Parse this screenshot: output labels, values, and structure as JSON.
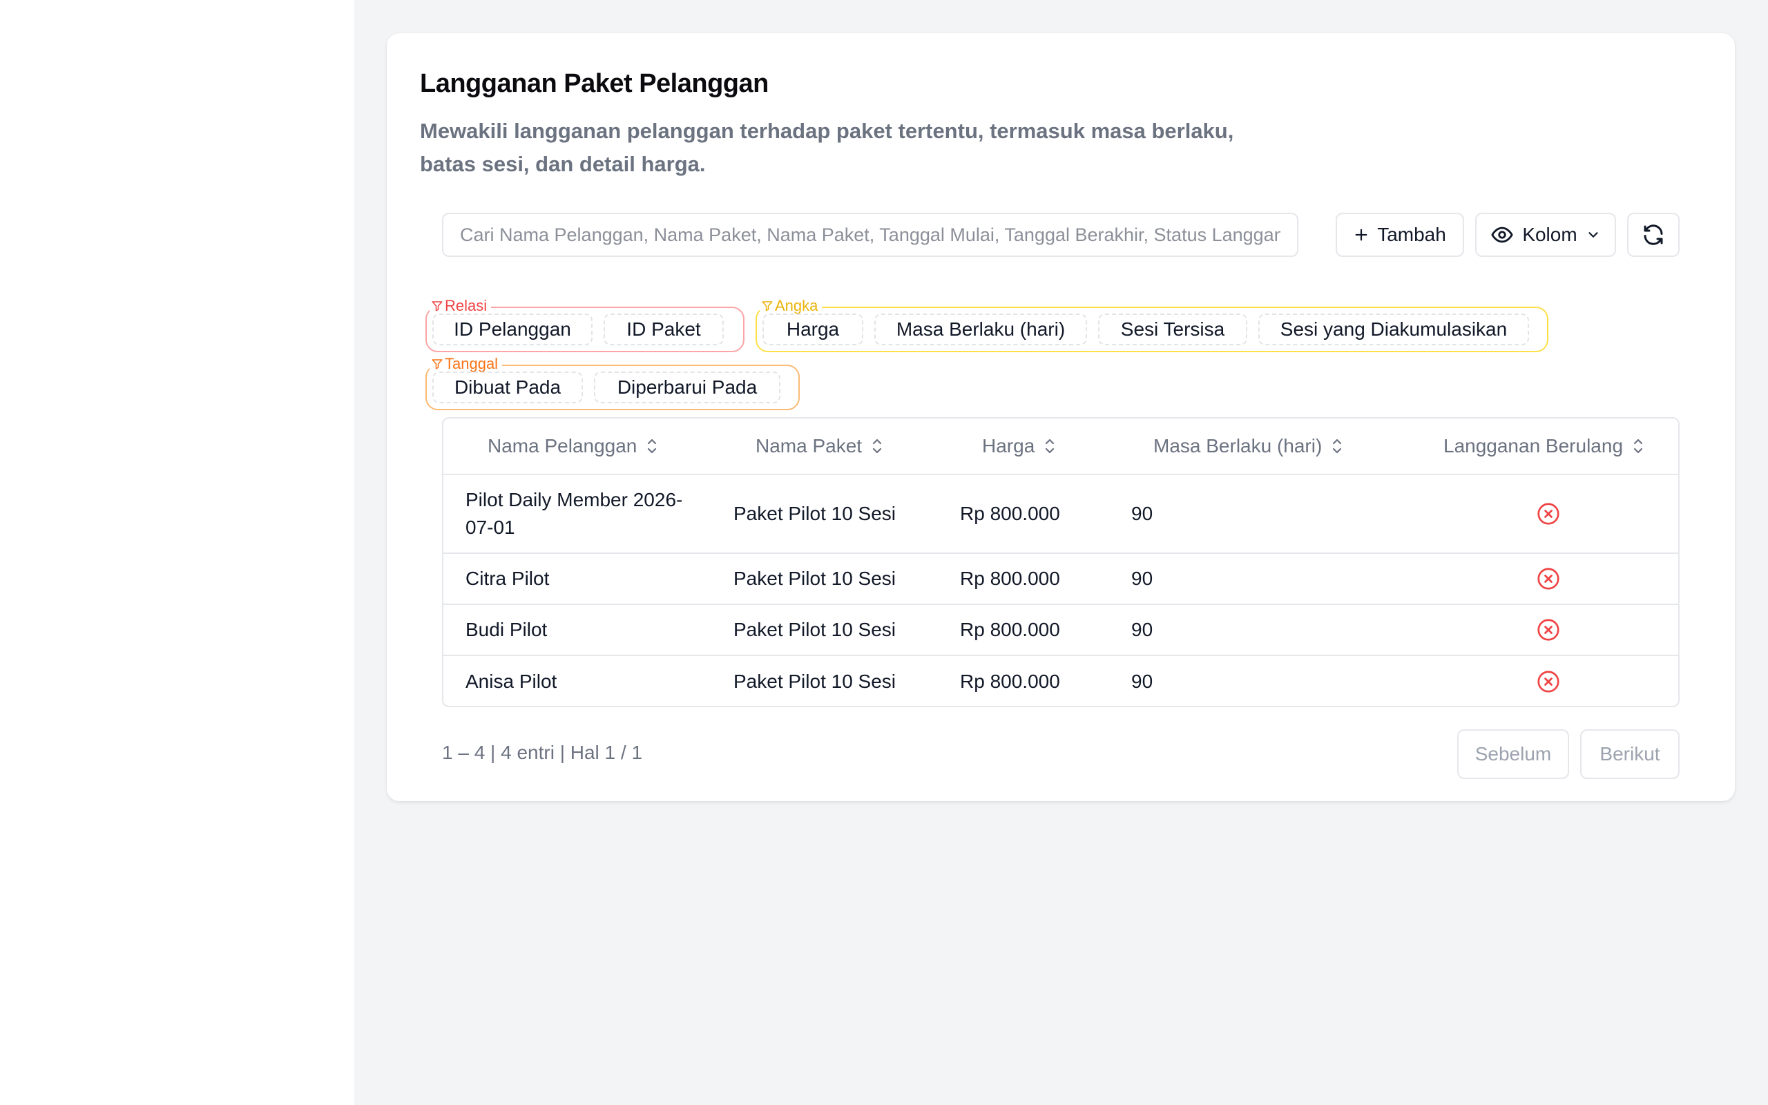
{
  "page": {
    "title": "Langganan Paket Pelanggan",
    "subtitle_line1": "Mewakili langganan pelanggan terhadap paket tertentu, termasuk masa berlaku,",
    "subtitle_line2": "batas sesi, dan detail harga."
  },
  "toolbar": {
    "search_placeholder": "Cari Nama Pelanggan, Nama Paket, Nama Paket, Tanggal Mulai, Tanggal Berakhir, Status Langganan",
    "add_label": "Tambah",
    "columns_label": "Kolom"
  },
  "filters": {
    "relasi": {
      "label": "Relasi",
      "chips": [
        "ID Pelanggan",
        "ID Paket"
      ]
    },
    "angka": {
      "label": "Angka",
      "chips": [
        "Harga",
        "Masa Berlaku (hari)",
        "Sesi Tersisa",
        "Sesi yang Diakumulasikan"
      ]
    },
    "tanggal": {
      "label": "Tanggal",
      "chips": [
        "Dibuat Pada",
        "Diperbarui Pada"
      ]
    }
  },
  "table": {
    "columns": [
      "Nama Pelanggan",
      "Nama Paket",
      "Harga",
      "Masa Berlaku (hari)",
      "Langganan Berulang"
    ],
    "rows": [
      {
        "name": "Pilot Daily Member 2026-07-01",
        "paket": "Paket Pilot 10 Sesi",
        "harga": "Rp 800.000",
        "masa": "90",
        "berulang": false
      },
      {
        "name": "Citra Pilot",
        "paket": "Paket Pilot 10 Sesi",
        "harga": "Rp 800.000",
        "masa": "90",
        "berulang": false
      },
      {
        "name": "Budi Pilot",
        "paket": "Paket Pilot 10 Sesi",
        "harga": "Rp 800.000",
        "masa": "90",
        "berulang": false
      },
      {
        "name": "Anisa Pilot",
        "paket": "Paket Pilot 10 Sesi",
        "harga": "Rp 800.000",
        "masa": "90",
        "berulang": false
      }
    ]
  },
  "pagination": {
    "summary": "1 – 4 | 4 entri | Hal 1 / 1",
    "prev_label": "Sebelum",
    "next_label": "Berikut"
  },
  "colors": {
    "relasi": "#ef4444",
    "angka": "#eab308",
    "tanggal": "#f97316",
    "false_icon": "#ef4444"
  },
  "icons": {
    "add": "plus-icon",
    "columns": "eye-icon",
    "columns_dropdown": "chevron-down-icon",
    "refresh": "refresh-icon",
    "filter": "filter-icon",
    "sort": "sort-icon",
    "false": "x-circle-icon"
  }
}
